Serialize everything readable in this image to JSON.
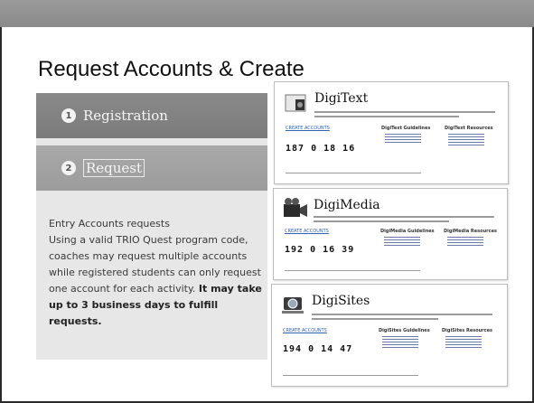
{
  "slide": {
    "title": "Request Accounts & Create"
  },
  "steps": [
    {
      "number": "1",
      "label": "Registration"
    },
    {
      "number": "2",
      "label": "Request"
    }
  ],
  "info": {
    "heading": "Entry Accounts requests",
    "body": "Using a valid TRIO Quest program code, coaches may request multiple accounts while registered students can only request one account for each activity.",
    "emphasis": "It may take up to 3 business days to fulfill requests."
  },
  "cards": [
    {
      "title": "DigiText",
      "counter": "187 0 18 16",
      "guidelines": "DigiText Guidelines",
      "resources": "DigiText Resources",
      "link": "CREATE ACCOUNTS"
    },
    {
      "title": "DigiMedia",
      "counter": "192 0 16 39",
      "guidelines": "DigiMedia Guidelines",
      "resources": "DigiMedia Resources",
      "link": "CREATE ACCOUNTS"
    },
    {
      "title": "DigiSites",
      "counter": "194 0 14 47",
      "guidelines": "DigiSites Guidelines",
      "resources": "DigiSites Resources",
      "link": "CREATE ACCOUNTS"
    }
  ]
}
